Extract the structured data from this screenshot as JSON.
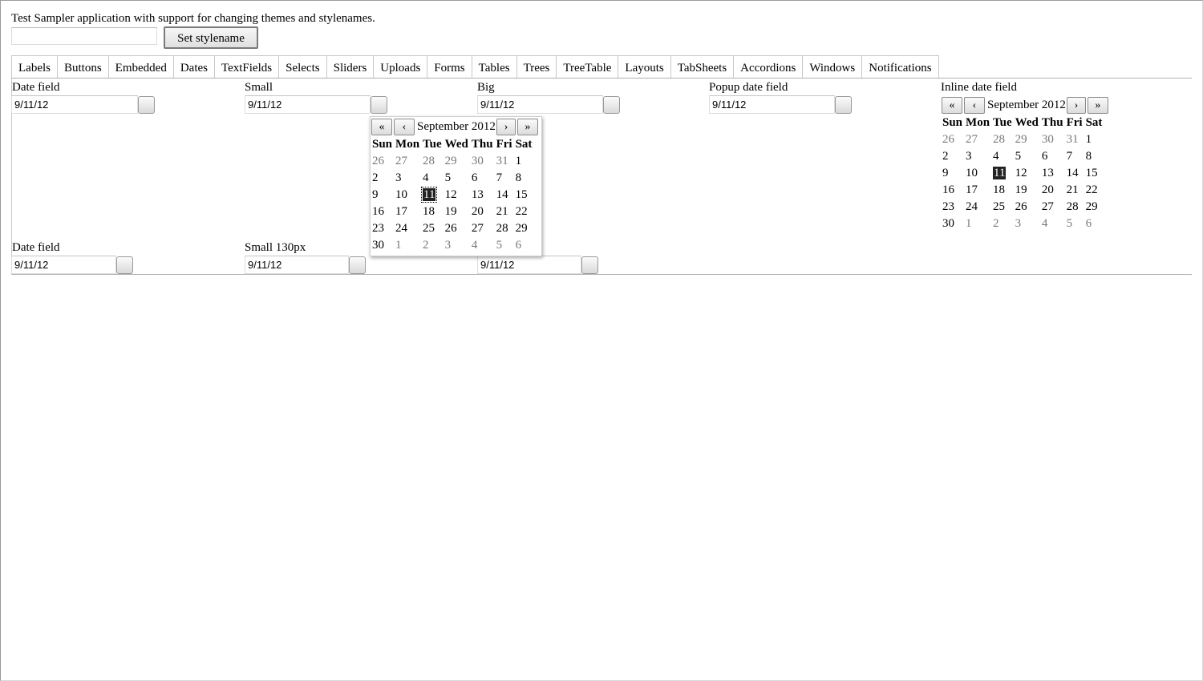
{
  "header": {
    "description": "Test Sampler application with support for changing themes and stylenames.",
    "stylename_input_value": "",
    "set_stylename_label": "Set stylename"
  },
  "tabs": [
    "Labels",
    "Buttons",
    "Embedded",
    "Dates",
    "TextFields",
    "Selects",
    "Sliders",
    "Uploads",
    "Forms",
    "Tables",
    "Trees",
    "TreeTable",
    "Layouts",
    "TabSheets",
    "Accordions",
    "Windows",
    "Notifications"
  ],
  "active_tab": "Dates",
  "row1": {
    "date_field": {
      "label": "Date field",
      "value": "9/11/12"
    },
    "small": {
      "label": "Small",
      "value": "9/11/12"
    },
    "big": {
      "label": "Big",
      "value": "9/11/12"
    },
    "popup": {
      "label": "Popup date field",
      "value": "9/11/12"
    },
    "inline": {
      "label": "Inline date field"
    }
  },
  "row2": {
    "date_field": {
      "label": "Date field",
      "value": "9/11/12"
    },
    "small130": {
      "label": "Small 130px",
      "value": "9/11/12"
    },
    "third": {
      "value": "9/11/12"
    }
  },
  "calendar": {
    "month_label": "September 2012",
    "nav": {
      "prev_year": "«",
      "prev_month": "‹",
      "next_month": "›",
      "next_year": "»"
    },
    "weekdays": [
      "Sun",
      "Mon",
      "Tue",
      "Wed",
      "Thu",
      "Fri",
      "Sat"
    ],
    "weeks": [
      [
        "26",
        "27",
        "28",
        "29",
        "30",
        "31",
        "1"
      ],
      [
        "2",
        "3",
        "4",
        "5",
        "6",
        "7",
        "8"
      ],
      [
        "9",
        "10",
        "11",
        "12",
        "13",
        "14",
        "15"
      ],
      [
        "16",
        "17",
        "18",
        "19",
        "20",
        "21",
        "22"
      ],
      [
        "23",
        "24",
        "25",
        "26",
        "27",
        "28",
        "29"
      ],
      [
        "30",
        "1",
        "2",
        "3",
        "4",
        "5",
        "6"
      ]
    ],
    "other_month_cells": [
      [
        0,
        0
      ],
      [
        0,
        1
      ],
      [
        0,
        2
      ],
      [
        0,
        3
      ],
      [
        0,
        4
      ],
      [
        0,
        5
      ],
      [
        5,
        1
      ],
      [
        5,
        2
      ],
      [
        5,
        3
      ],
      [
        5,
        4
      ],
      [
        5,
        5
      ],
      [
        5,
        6
      ]
    ],
    "selected_day": "11"
  }
}
